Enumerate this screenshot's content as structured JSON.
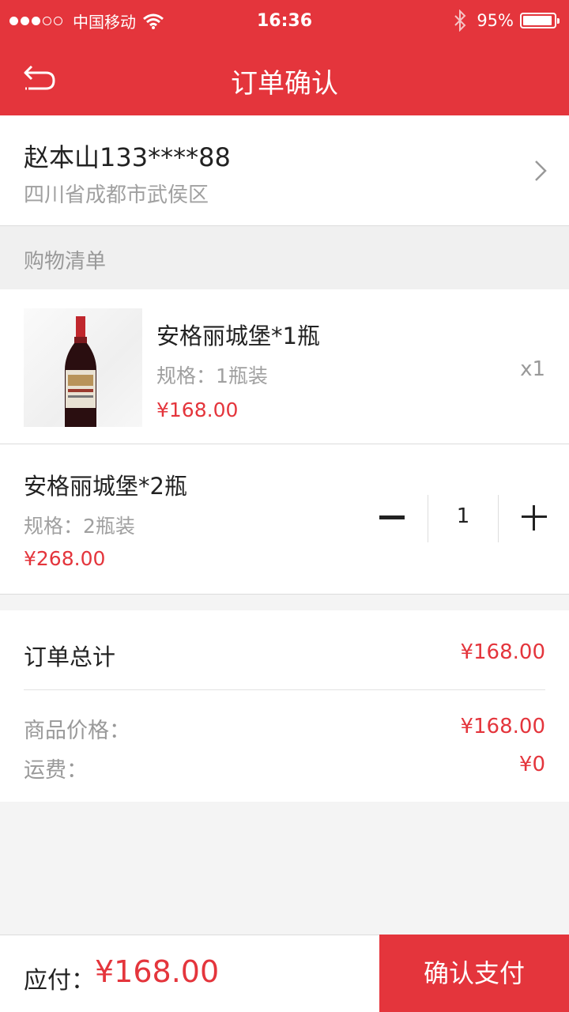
{
  "status_bar": {
    "carrier": "中国移动",
    "time": "16:36",
    "battery_text": "95%",
    "battery_level": 0.95
  },
  "nav": {
    "title": "订单确认",
    "back_icon": "back-arrow-icon"
  },
  "address": {
    "name_phone": "赵本山133****88",
    "location": "四川省成都市武侯区",
    "chevron_icon": "chevron-right-icon"
  },
  "shopping_list": {
    "header": "购物清单",
    "items": [
      {
        "title": "安格丽城堡*1瓶",
        "spec": "规格：1瓶装",
        "price": "¥168.00",
        "quantity": "x1",
        "image": "wine-bottle"
      },
      {
        "title": "安格丽城堡*2瓶",
        "spec": "规格：2瓶装",
        "price": "¥268.00",
        "quantity_value": "1"
      }
    ]
  },
  "totals": {
    "order_total_label": "订单总计",
    "order_total_value": "¥168.00",
    "goods_price_label": "商品价格：",
    "goods_price_value": "¥168.00",
    "shipping_label": "运费：",
    "shipping_value": "¥0"
  },
  "footer": {
    "payable_label": "应付：",
    "payable_amount": "¥168.00",
    "confirm_button": "确认支付"
  },
  "colors": {
    "accent": "#e4353c",
    "background": "#f4f4f4"
  }
}
